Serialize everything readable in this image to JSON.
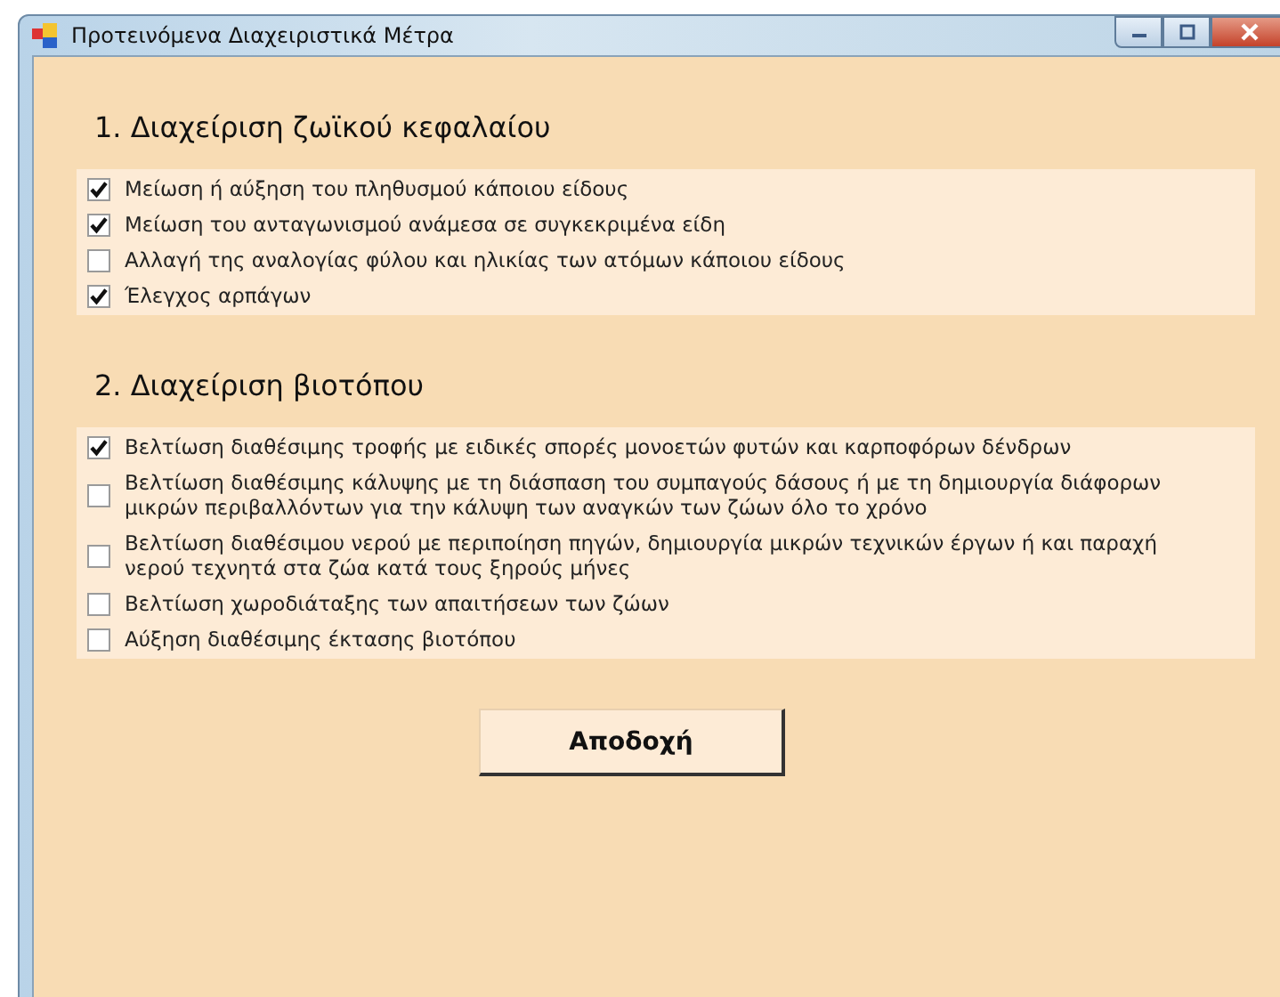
{
  "window": {
    "title": "Προτεινόμενα Διαχειριστικά Μέτρα"
  },
  "sections": [
    {
      "heading": "1. Διαχείριση ζωϊκού κεφαλαίου",
      "options": [
        {
          "label": "Μείωση ή αύξηση του πληθυσμού κάποιου είδους",
          "checked": true
        },
        {
          "label": "Μείωση του ανταγωνισμού ανάμεσα σε συγκεκριμένα είδη",
          "checked": true
        },
        {
          "label": "Αλλαγή της αναλογίας φύλου και ηλικίας των ατόμων κάποιου είδους",
          "checked": false
        },
        {
          "label": "Έλεγχος αρπάγων",
          "checked": true
        }
      ]
    },
    {
      "heading": "2.  Διαχείριση βιοτόπου",
      "options": [
        {
          "label": "Βελτίωση διαθέσιμης τροφής με ειδικές σπορές μονοετών φυτών και καρποφόρων δένδρων",
          "checked": true
        },
        {
          "label": "Βελτίωση διαθέσιμης κάλυψης με τη διάσπαση του συμπαγούς δάσους ή με τη δημιουργία διάφορων μικρών περιβαλλόντων για την κάλυψη των αναγκών των ζώων όλο το χρόνο",
          "checked": false
        },
        {
          "label": "Βελτίωση διαθέσιμου νερού με περιποίηση πηγών, δημιουργία μικρών τεχνικών έργων ή και παραχή νερού τεχνητά στα ζώα κατά τους ξηρούς μήνες",
          "checked": false
        },
        {
          "label": "Βελτίωση χωροδιάταξης των απαιτήσεων των ζώων",
          "checked": false
        },
        {
          "label": "Αύξηση διαθέσιμης έκτασης βιοτόπου",
          "checked": false
        }
      ]
    }
  ],
  "accept_button": "Αποδοχή"
}
